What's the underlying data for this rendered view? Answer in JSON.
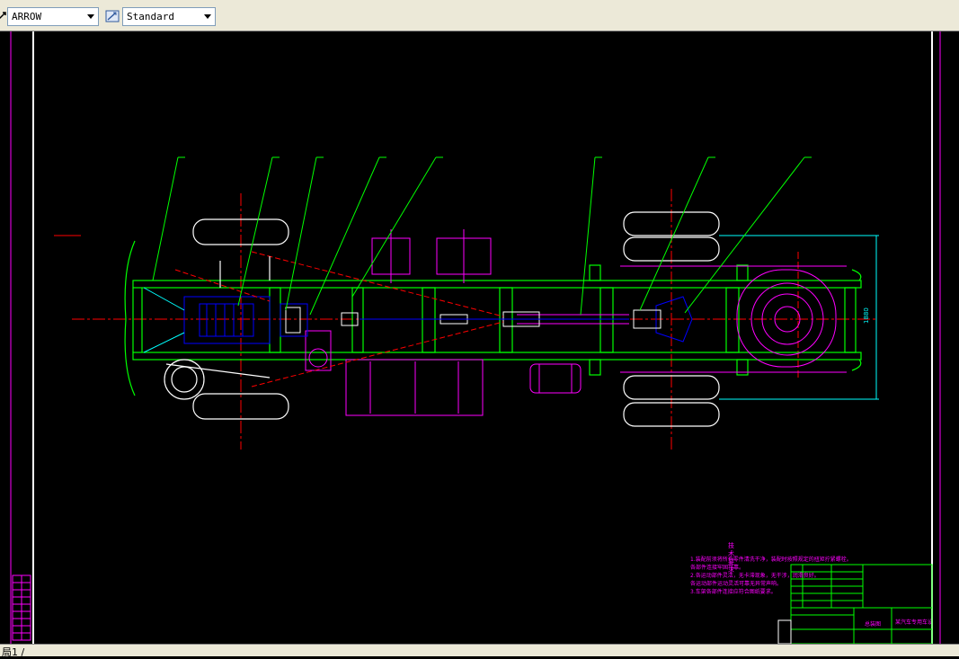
{
  "toolbar": {
    "dimstyle_icon": "arrow-dim-icon",
    "arrow_value": "ARROW",
    "textstyle_icon": "text-style-icon",
    "standard_value": "Standard"
  },
  "status": {
    "layout_tab": "局1 /"
  },
  "drawing": {
    "dimension_width": "1880",
    "notes_title": "技术要求",
    "notes_lines": [
      "1.装配前须将所有零件清洗干净，装配时按照规定的扭矩拧紧螺栓。",
      "  各部件连接牢固可靠。",
      "2.各运动部件灵活，无卡滞现象，无干涉，润滑良好。",
      "  各运动部件运动灵活可靠无异常声响。",
      "3.车架各部件连接应符合图纸要求。"
    ],
    "title_block_name": "总装图",
    "title_block_school": "某汽车专用车设计"
  },
  "colors": {
    "frame": "#00ff00",
    "centerline": "#ff0000",
    "component": "#ff00ff",
    "outline": "#ffffff",
    "dimension": "#00ffff",
    "engine": "#0000ff"
  }
}
